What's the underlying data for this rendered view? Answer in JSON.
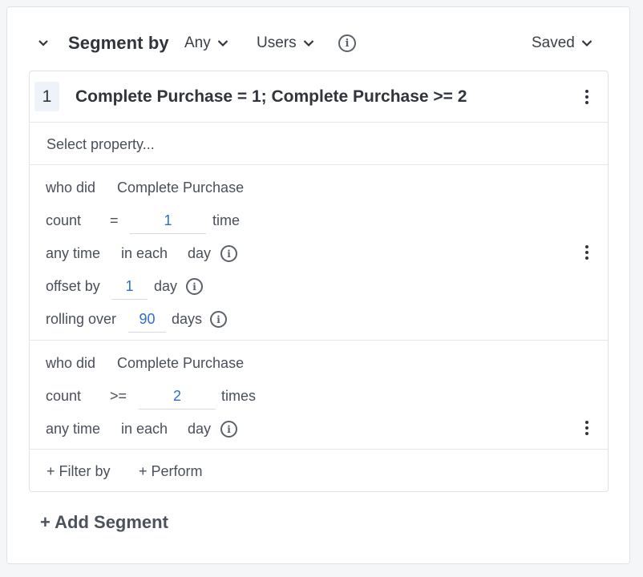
{
  "header": {
    "title": "Segment by",
    "any_label": "Any",
    "users_label": "Users",
    "saved_label": "Saved",
    "info_icon": "info-icon"
  },
  "segment": {
    "number": "1",
    "name": "Complete Purchase = 1; Complete Purchase >= 2",
    "select_property_placeholder": "Select property...",
    "conditions": [
      {
        "who_did": "who did",
        "event": "Complete Purchase",
        "count_label": "count",
        "operator": "=",
        "value": "1",
        "unit": "time",
        "any_time": "any time",
        "in_each": "in each",
        "interval": "day",
        "offset_label": "offset by",
        "offset_value": "1",
        "offset_unit": "day",
        "rolling_label": "rolling over",
        "rolling_value": "90",
        "rolling_unit": "days"
      },
      {
        "who_did": "who did",
        "event": "Complete Purchase",
        "count_label": "count",
        "operator": ">=",
        "value": "2",
        "unit": "times",
        "any_time": "any time",
        "in_each": "in each",
        "interval": "day"
      }
    ],
    "filter_by": "+ Filter by",
    "perform": "+ Perform"
  },
  "add_segment": "+ Add Segment",
  "colors": {
    "accent": "#2b6fd1",
    "text": "#30343b",
    "border": "#dfe2e6"
  }
}
